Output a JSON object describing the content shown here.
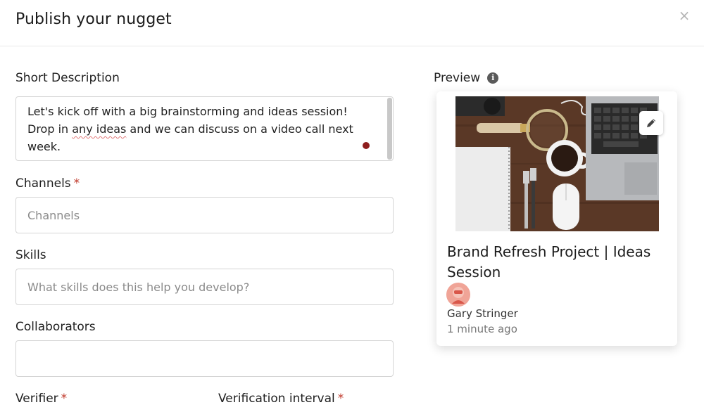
{
  "modal": {
    "title": "Publish your nugget",
    "close_icon": "close-icon"
  },
  "form": {
    "short_description": {
      "label": "Short Description",
      "text_before": "Let's kick off with a big brainstorming and ideas session! Drop in ",
      "text_misspelled": "any ideas",
      "text_after": " and we can discuss on a video call next week."
    },
    "channels": {
      "label": "Channels",
      "required": "*",
      "placeholder": "Channels"
    },
    "skills": {
      "label": "Skills",
      "placeholder": "What skills does this help you develop?"
    },
    "collaborators": {
      "label": "Collaborators",
      "value": ""
    },
    "verifier": {
      "label": "Verifier",
      "required": "*"
    },
    "verification_interval": {
      "label": "Verification interval",
      "required": "*"
    }
  },
  "preview": {
    "label": "Preview",
    "info_icon": "info-icon",
    "card": {
      "image_icon": "desk-photo",
      "edit_icon": "pencil-icon",
      "title": "Brand Refresh Project | Ideas Session",
      "author": "Gary Stringer",
      "time": "1 minute ago"
    }
  },
  "colors": {
    "required": "#c0392b",
    "border": "#d5d5d5",
    "avatar": "#f0a497"
  }
}
